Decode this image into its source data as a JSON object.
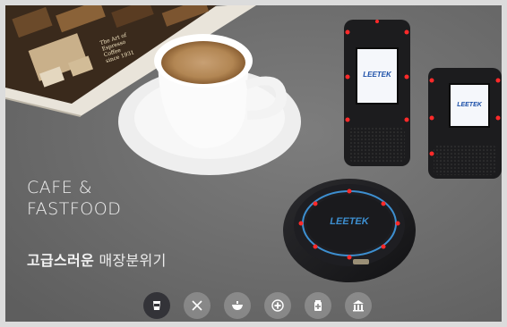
{
  "hero": {
    "line1": "CAFE &",
    "line2": "FASTFOOD",
    "subtitle_strong": "고급스러운",
    "subtitle_light": "매장분위기"
  },
  "book": {
    "line1": "The Art of",
    "line2": "Espresso Coffee",
    "line3": "since 1931"
  },
  "devices": {
    "brand": "LEETEK"
  },
  "nav": {
    "items": [
      {
        "name": "cafe",
        "icon": "coffee-cup-icon",
        "active": true
      },
      {
        "name": "restaurant",
        "icon": "fork-knife-icon",
        "active": false
      },
      {
        "name": "food-court",
        "icon": "bowl-icon",
        "active": false
      },
      {
        "name": "hospital",
        "icon": "medical-cross-icon",
        "active": false
      },
      {
        "name": "pharmacy",
        "icon": "pharmacy-icon",
        "active": false
      },
      {
        "name": "public-office",
        "icon": "building-icon",
        "active": false
      }
    ]
  },
  "colors": {
    "background": "#dcdcdc",
    "table": "#707070",
    "active_icon": "#333338",
    "pager_led": "#ff2a2a",
    "screen_blue": "#1b4fa8"
  }
}
